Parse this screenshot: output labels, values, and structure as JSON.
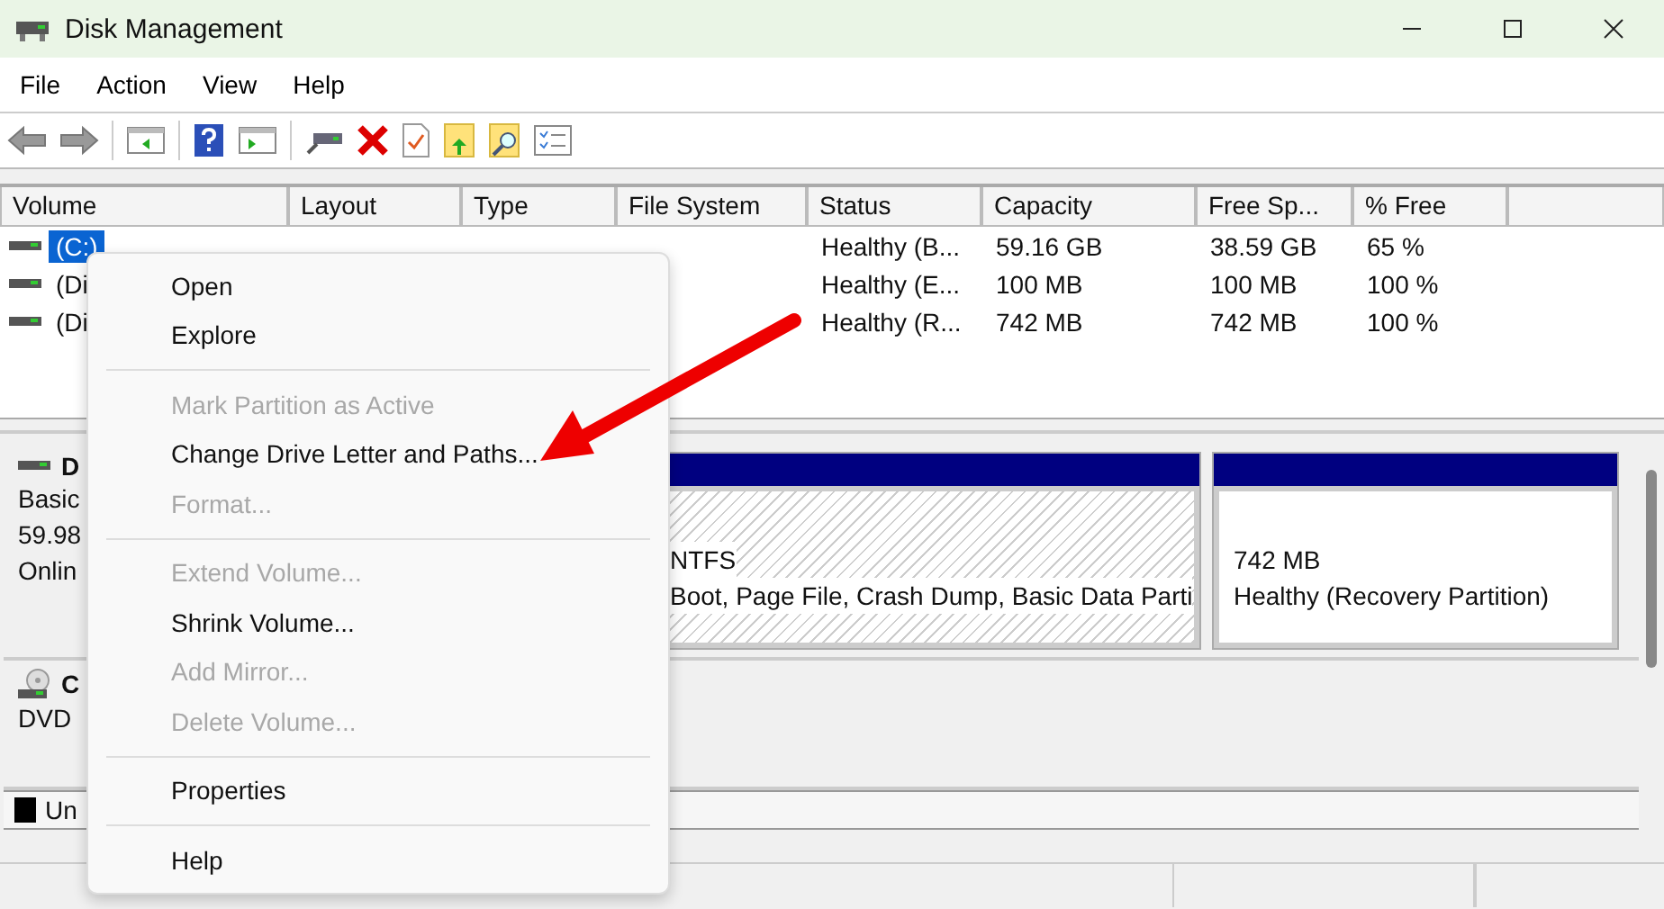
{
  "window": {
    "title": "Disk Management"
  },
  "menu_bar": [
    "File",
    "Action",
    "View",
    "Help"
  ],
  "table": {
    "columns": [
      "Volume",
      "Layout",
      "Type",
      "File System",
      "Status",
      "Capacity",
      "Free Sp...",
      "% Free"
    ],
    "rows": [
      {
        "cells": [
          "(C:)",
          null,
          null,
          null,
          "Healthy (B...",
          "59.16 GB",
          "38.59 GB",
          "65 %"
        ],
        "selected": true
      },
      {
        "cells": [
          "(Di",
          null,
          null,
          null,
          "Healthy (E...",
          "100 MB",
          "100 MB",
          "100 %"
        ],
        "selected": false
      },
      {
        "cells": [
          "(Di",
          null,
          null,
          null,
          "Healthy (R...",
          "742 MB",
          "742 MB",
          "100 %"
        ],
        "selected": false
      }
    ]
  },
  "disks": [
    {
      "kind": "hdd",
      "name": "D",
      "lines": [
        "Basic",
        "59.98",
        "Onlin"
      ],
      "partitions": [
        {
          "kind": "hatched",
          "lines": [
            "NTFS",
            "Boot, Page File, Crash Dump, Basic Data Parti"
          ]
        },
        {
          "kind": "plain",
          "lines": [
            "742 MB",
            "Healthy (Recovery Partition)"
          ]
        }
      ]
    },
    {
      "kind": "dvd",
      "name": "C",
      "lines": [
        "DVD"
      ]
    }
  ],
  "legend": [
    {
      "label": "Un",
      "color": "#000000"
    }
  ],
  "context_menu": [
    {
      "kind": "item",
      "label": "Open",
      "disabled": false
    },
    {
      "kind": "item",
      "label": "Explore",
      "disabled": false
    },
    {
      "kind": "separator"
    },
    {
      "kind": "item",
      "label": "Mark Partition as Active",
      "disabled": true
    },
    {
      "kind": "item",
      "label": "Change Drive Letter and Paths...",
      "disabled": false
    },
    {
      "kind": "item",
      "label": "Format...",
      "disabled": true
    },
    {
      "kind": "separator"
    },
    {
      "kind": "item",
      "label": "Extend Volume...",
      "disabled": true
    },
    {
      "kind": "item",
      "label": "Shrink Volume...",
      "disabled": false
    },
    {
      "kind": "item",
      "label": "Add Mirror...",
      "disabled": true
    },
    {
      "kind": "item",
      "label": "Delete Volume...",
      "disabled": true
    },
    {
      "kind": "separator"
    },
    {
      "kind": "item",
      "label": "Properties",
      "disabled": false
    },
    {
      "kind": "separator"
    },
    {
      "kind": "item",
      "label": "Help",
      "disabled": false
    }
  ]
}
